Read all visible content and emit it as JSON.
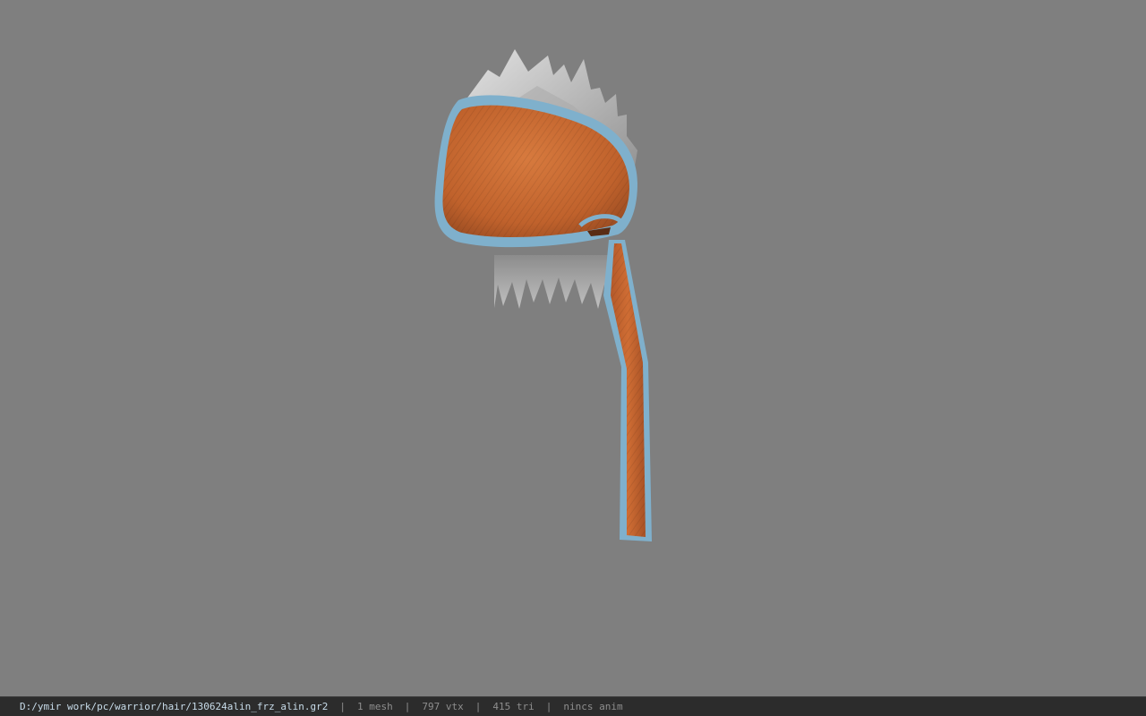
{
  "viewport": {
    "background": "#7f7f7f",
    "model": {
      "object": "hair-helmet-model",
      "colors": {
        "cloth": "#c86b32",
        "cloth_dark": "#9a4c22",
        "trim": "#7fb0cc",
        "hair": "#c9c9c9",
        "hair_shadow": "#8a8a8a"
      }
    }
  },
  "status_bar": {
    "file_path": "D:/ymir work/pc/warrior/hair/130624alin_frz_alin.gr2",
    "mesh_count": "1 mesh",
    "vertex_count": "797 vtx",
    "triangle_count": "415 tri",
    "anim_status": "nincs anim",
    "separator": "|"
  }
}
